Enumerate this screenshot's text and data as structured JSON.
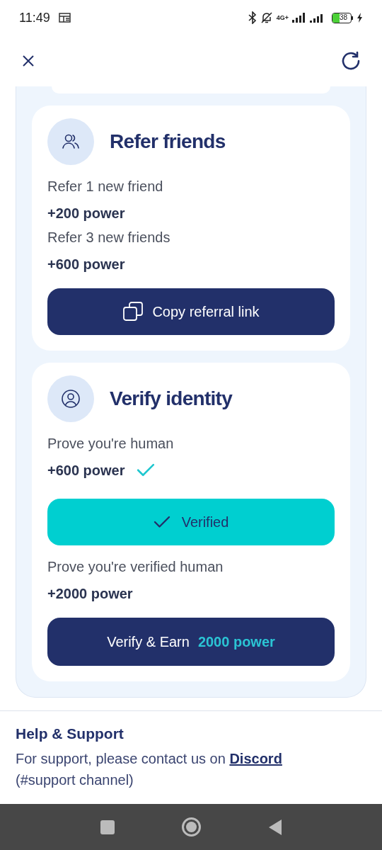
{
  "status_bar": {
    "time": "11:49",
    "network": "4G+",
    "battery": "38"
  },
  "cards": [
    {
      "title": "Refer friends",
      "rewards": [
        {
          "label": "Refer 1 new friend",
          "power": "+200 power",
          "verified": false
        },
        {
          "label": "Refer 3 new friends",
          "power": "+600 power",
          "verified": false
        }
      ],
      "button": {
        "kind": "copy",
        "label": "Copy referral link"
      }
    },
    {
      "title": "Verify identity",
      "rewards": [
        {
          "label": "Prove you're human",
          "power": "+600 power",
          "verified": true
        },
        {
          "kind": "button",
          "button": {
            "kind": "verified",
            "label": "Verified"
          }
        },
        {
          "label": "Prove you're verified human",
          "power": "+2000 power",
          "verified": false
        }
      ],
      "button": {
        "kind": "earn",
        "label": "Verify & Earn",
        "highlight": "2000 power"
      }
    }
  ],
  "help": {
    "title": "Help & Support",
    "text": "For support, please contact us on",
    "link": "Discord",
    "text_after": "(#support channel)"
  }
}
